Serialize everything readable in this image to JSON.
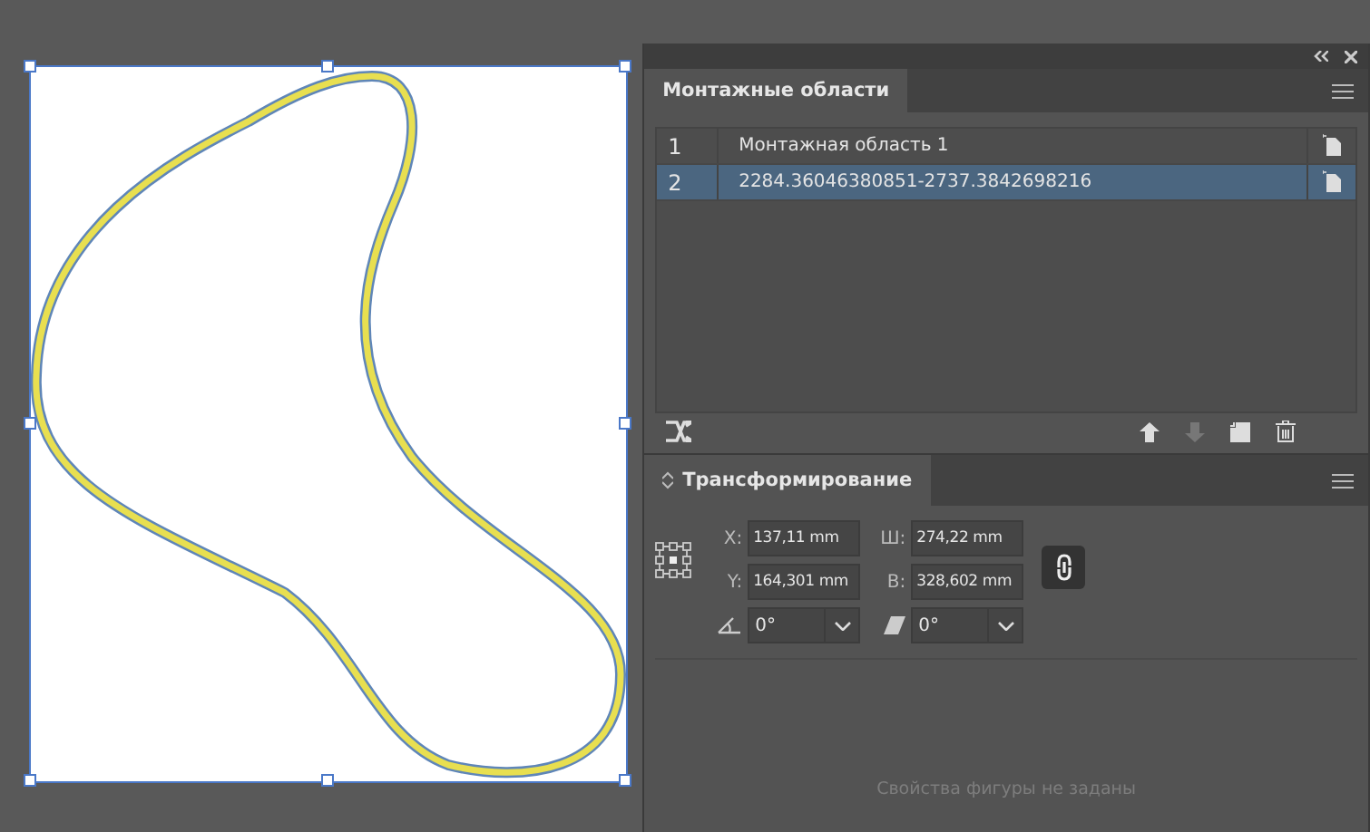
{
  "artboards_panel": {
    "tab": "Монтажные области",
    "rows": [
      {
        "number": "1",
        "name": "Монтажная область 1",
        "selected": false
      },
      {
        "number": "2",
        "name": "2284.36046380851-2737.3842698216",
        "selected": true
      }
    ]
  },
  "transform_panel": {
    "tab": "Трансформирование",
    "fields": [
      {
        "label": "X:",
        "value": "137,11 mm"
      },
      {
        "label": "Ш:",
        "value": "274,22 mm"
      },
      {
        "label": "Y:",
        "value": "164,301 mm"
      },
      {
        "label": "В:",
        "value": "328,602 mm"
      }
    ],
    "rotate": "0°",
    "shear": "0°",
    "empty_message": "Свойства фигуры не заданы"
  }
}
